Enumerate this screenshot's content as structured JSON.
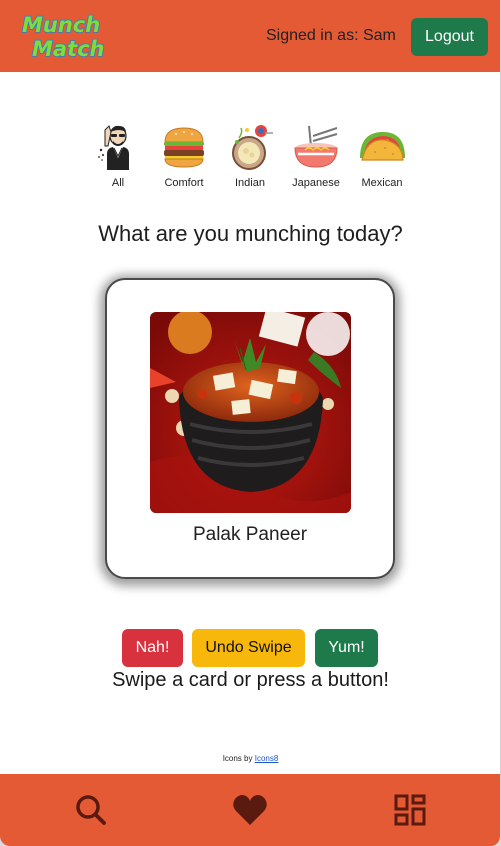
{
  "header": {
    "logo_line1": "Munch",
    "logo_line2": "Match",
    "signed_in_text": "Signed in as: Sam",
    "logout_label": "Logout"
  },
  "categories": [
    {
      "label": "All",
      "icon": "person-icon"
    },
    {
      "label": "Comfort",
      "icon": "burger-icon"
    },
    {
      "label": "Indian",
      "icon": "curry-bowl-icon"
    },
    {
      "label": "Japanese",
      "icon": "ramen-bowl-icon"
    },
    {
      "label": "Mexican",
      "icon": "taco-icon"
    }
  ],
  "main": {
    "heading": "What are you munching today?",
    "card": {
      "dish_name": "Palak Paneer"
    },
    "actions": {
      "nah_label": "Nah!",
      "undo_label": "Undo Swipe",
      "yum_label": "Yum!"
    },
    "instructions": "Swipe a card or press a button!"
  },
  "credit": {
    "prefix": "Icons by",
    "link_text": "Icons8"
  },
  "bottom_nav": [
    {
      "icon": "search-icon"
    },
    {
      "icon": "heart-icon"
    },
    {
      "icon": "dashboard-icon"
    }
  ],
  "colors": {
    "brand": "#e35a35",
    "primary_green": "#1f7a4b",
    "danger": "#d8323f",
    "warning": "#f8b80b",
    "icon_dark": "#5a1a10"
  }
}
